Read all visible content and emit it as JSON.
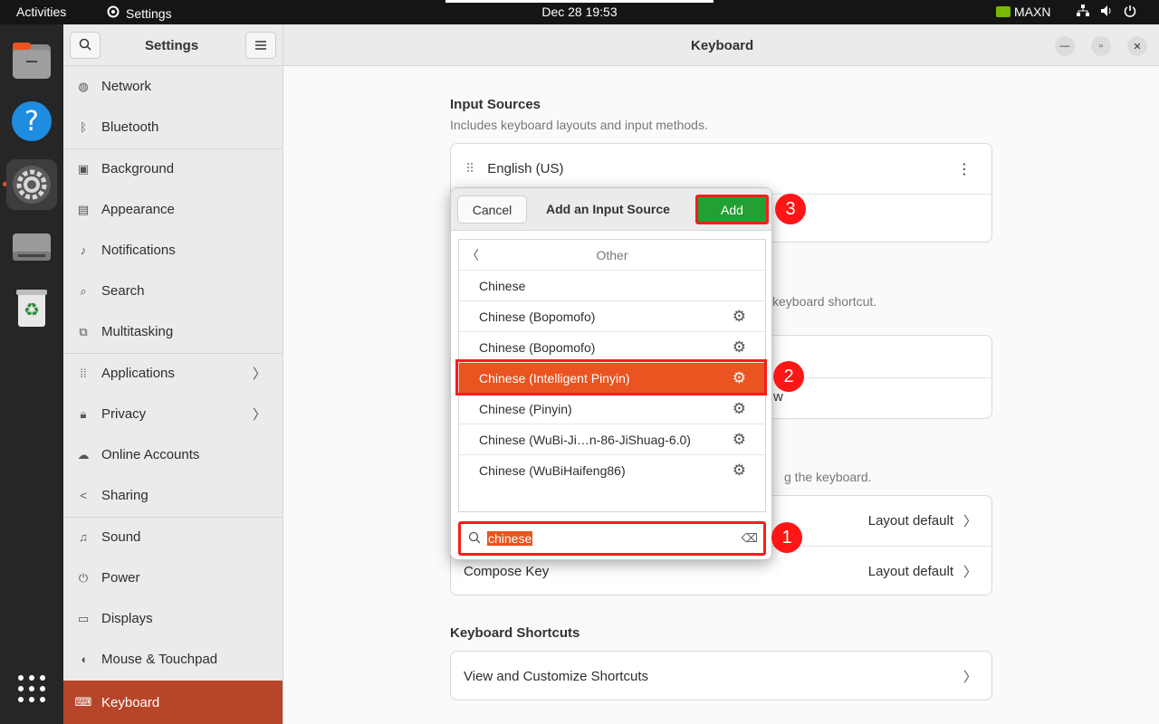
{
  "topbar": {
    "activities": "Activities",
    "app_name": "Settings",
    "clock": "Dec 28  19:53",
    "maxn": "MAXN"
  },
  "dock": {
    "items": [
      {
        "name": "files-icon"
      },
      {
        "name": "help-icon"
      },
      {
        "name": "settings-icon"
      },
      {
        "name": "disk-icon"
      },
      {
        "name": "trash-icon"
      },
      {
        "name": "app-grid-icon"
      }
    ]
  },
  "sidebar": {
    "title": "Settings",
    "items": [
      {
        "label": "Network",
        "icon": "globe-icon"
      },
      {
        "label": "Bluetooth",
        "icon": "bluetooth-icon"
      },
      {
        "label": "Background",
        "icon": "background-icon"
      },
      {
        "label": "Appearance",
        "icon": "appearance-icon"
      },
      {
        "label": "Notifications",
        "icon": "bell-icon"
      },
      {
        "label": "Search",
        "icon": "search-icon"
      },
      {
        "label": "Multitasking",
        "icon": "multitasking-icon"
      },
      {
        "label": "Applications",
        "icon": "apps-icon"
      },
      {
        "label": "Privacy",
        "icon": "lock-icon"
      },
      {
        "label": "Online Accounts",
        "icon": "cloud-icon"
      },
      {
        "label": "Sharing",
        "icon": "share-icon"
      },
      {
        "label": "Sound",
        "icon": "music-icon"
      },
      {
        "label": "Power",
        "icon": "power-icon"
      },
      {
        "label": "Displays",
        "icon": "display-icon"
      },
      {
        "label": "Mouse & Touchpad",
        "icon": "mouse-icon"
      },
      {
        "label": "Keyboard",
        "icon": "keyboard-icon"
      }
    ]
  },
  "main": {
    "title": "Keyboard",
    "input_sources": {
      "title": "Input Sources",
      "subtitle": "Includes keyboard layouts and input methods.",
      "first_source": "English (US)"
    },
    "partial_texts": {
      "shortcut_tail": "keyboard shortcut.",
      "row_tail": "w",
      "keyboard_tail": "g the keyboard."
    },
    "special_chars": {
      "alt_label": "",
      "alt_value": "Layout default",
      "compose_label": "Compose Key",
      "compose_value": "Layout default"
    },
    "shortcuts": {
      "title": "Keyboard Shortcuts",
      "row": "View and Customize Shortcuts"
    }
  },
  "dialog": {
    "cancel": "Cancel",
    "title": "Add an Input Source",
    "add": "Add",
    "category": "Other",
    "items": [
      {
        "label": "Chinese",
        "gear": false
      },
      {
        "label": "Chinese (Bopomofo)",
        "gear": true
      },
      {
        "label": "Chinese (Bopomofo)",
        "gear": true
      },
      {
        "label": "Chinese (Intelligent Pinyin)",
        "gear": true,
        "selected": true
      },
      {
        "label": "Chinese (Pinyin)",
        "gear": true
      },
      {
        "label": "Chinese (WuBi-Ji…n-86-JiShuag-6.0)",
        "gear": true
      },
      {
        "label": "Chinese (WuBiHaifeng86)",
        "gear": true
      }
    ],
    "search_value": "chinese"
  },
  "annotations": [
    "1",
    "2",
    "3"
  ]
}
